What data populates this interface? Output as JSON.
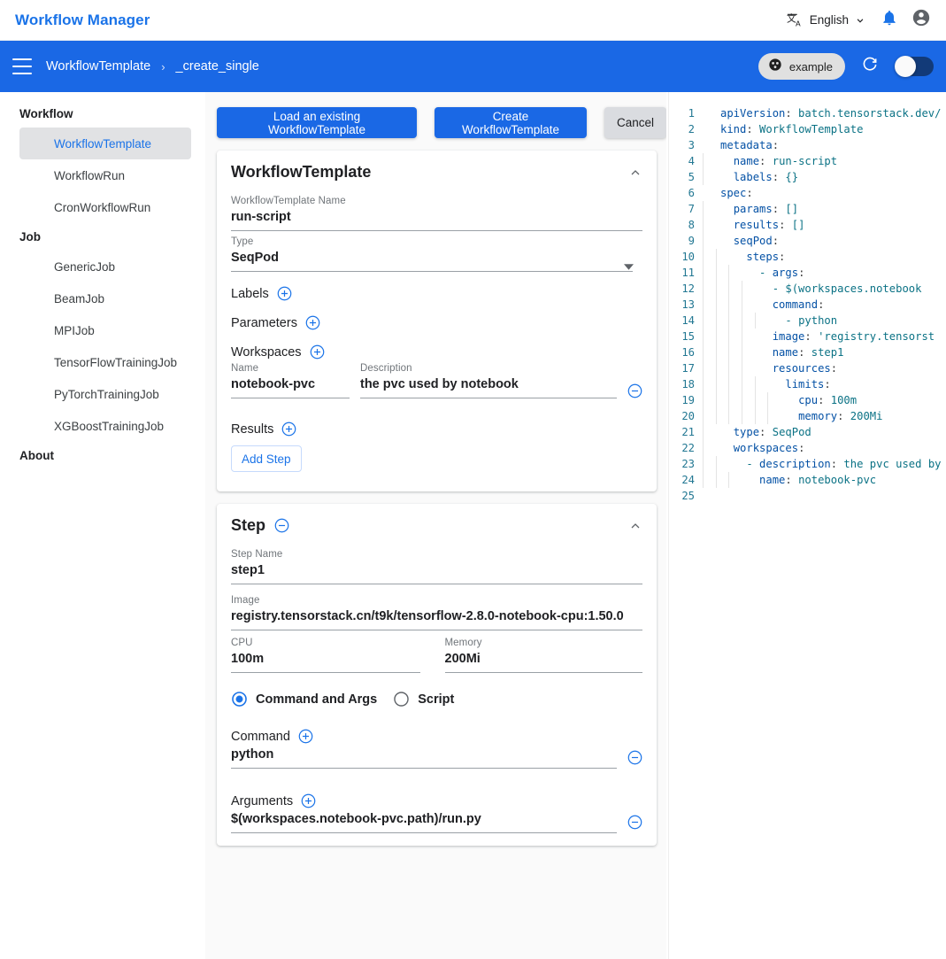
{
  "header": {
    "brand": "Workflow Manager",
    "translate_icon": "translate-icon",
    "language": "English",
    "chevron_icon": "chevron-down-icon",
    "bell_icon": "notifications-bell-icon",
    "account_icon": "account-circle-icon"
  },
  "breadcrumb": {
    "menu_icon": "hamburger-menu-icon",
    "parent": "WorkflowTemplate",
    "separator": "›",
    "current": "_create_single",
    "namespace_chip": {
      "icon": "namespace-icon",
      "label": "example"
    },
    "refresh_icon": "refresh-icon",
    "toggle_on": true
  },
  "sidebar": {
    "groups": [
      {
        "label": "Workflow",
        "items": [
          {
            "label": "WorkflowTemplate",
            "active": true
          },
          {
            "label": "WorkflowRun",
            "active": false
          },
          {
            "label": "CronWorkflowRun",
            "active": false
          }
        ]
      },
      {
        "label": "Job",
        "items": [
          {
            "label": "GenericJob",
            "active": false
          },
          {
            "label": "BeamJob",
            "active": false
          },
          {
            "label": "MPIJob",
            "active": false
          },
          {
            "label": "TensorFlowTrainingJob",
            "active": false
          },
          {
            "label": "PyTorchTrainingJob",
            "active": false
          },
          {
            "label": "XGBoostTrainingJob",
            "active": false
          }
        ]
      },
      {
        "label": "About",
        "items": []
      }
    ]
  },
  "toolbar": {
    "load_label": "Load an existing WorkflowTemplate",
    "create_label": "Create WorkflowTemplate",
    "cancel_label": "Cancel"
  },
  "template_card": {
    "title": "WorkflowTemplate",
    "collapse_icon": "chevron-up-icon",
    "name_label": "WorkflowTemplate Name",
    "name_value": "run-script",
    "type_label": "Type",
    "type_value": "SeqPod",
    "type_caret_icon": "dropdown-caret-icon",
    "labels_label": "Labels",
    "parameters_label": "Parameters",
    "workspaces_label": "Workspaces",
    "ws_name_label": "Name",
    "ws_name_value": "notebook-pvc",
    "ws_desc_label": "Description",
    "ws_desc_value": "the pvc used by notebook",
    "results_label": "Results",
    "add_step_label": "Add Step",
    "add_icon": "add-circle-icon",
    "remove_icon": "remove-circle-icon"
  },
  "step_card": {
    "title": "Step",
    "remove_icon": "remove-circle-icon",
    "collapse_icon": "chevron-up-icon",
    "step_name_label": "Step Name",
    "step_name_value": "step1",
    "image_label": "Image",
    "image_value": "registry.tensorstack.cn/t9k/tensorflow-2.8.0-notebook-cpu:1.50.0",
    "cpu_label": "CPU",
    "cpu_value": "100m",
    "memory_label": "Memory",
    "memory_value": "200Mi",
    "mode_command_label": "Command and Args",
    "mode_script_label": "Script",
    "mode_selected": "Command and Args",
    "radio_selected_icon": "radio-button-checked-icon",
    "radio_unselected_icon": "radio-button-unchecked-icon",
    "command_label": "Command",
    "command_value": "python",
    "arguments_label": "Arguments",
    "arguments_value": "$(workspaces.notebook-pvc.path)/run.py",
    "add_icon": "add-circle-icon",
    "minus_icon": "remove-circle-icon"
  },
  "editor": {
    "lines": [
      {
        "n": "1",
        "indent": 0,
        "text": "apiVersion: batch.tensorstack.dev/"
      },
      {
        "n": "2",
        "indent": 0,
        "text": "kind: WorkflowTemplate"
      },
      {
        "n": "3",
        "indent": 0,
        "text": "metadata:"
      },
      {
        "n": "4",
        "indent": 1,
        "text": "name: run-script"
      },
      {
        "n": "5",
        "indent": 1,
        "text": "labels: {}"
      },
      {
        "n": "6",
        "indent": 0,
        "text": "spec:"
      },
      {
        "n": "7",
        "indent": 1,
        "text": "params: []"
      },
      {
        "n": "8",
        "indent": 1,
        "text": "results: []"
      },
      {
        "n": "9",
        "indent": 1,
        "text": "seqPod:"
      },
      {
        "n": "10",
        "indent": 2,
        "text": "steps:"
      },
      {
        "n": "11",
        "indent": 3,
        "text": "- args:"
      },
      {
        "n": "12",
        "indent": 4,
        "text": "- $(workspaces.notebook"
      },
      {
        "n": "13",
        "indent": 4,
        "text": "command:"
      },
      {
        "n": "14",
        "indent": 5,
        "text": "- python"
      },
      {
        "n": "15",
        "indent": 4,
        "text": "image: 'registry.tensorst"
      },
      {
        "n": "16",
        "indent": 4,
        "text": "name: step1"
      },
      {
        "n": "17",
        "indent": 4,
        "text": "resources:"
      },
      {
        "n": "18",
        "indent": 5,
        "text": "limits:"
      },
      {
        "n": "19",
        "indent": 6,
        "text": "cpu: 100m"
      },
      {
        "n": "20",
        "indent": 6,
        "text": "memory: 200Mi"
      },
      {
        "n": "21",
        "indent": 1,
        "text": "type: SeqPod"
      },
      {
        "n": "22",
        "indent": 1,
        "text": "workspaces:"
      },
      {
        "n": "23",
        "indent": 2,
        "text": "- description: the pvc used by"
      },
      {
        "n": "24",
        "indent": 3,
        "text": "name: notebook-pvc"
      },
      {
        "n": "25",
        "indent": 0,
        "text": ""
      }
    ]
  },
  "colors": {
    "accent_blue": "#1a68e5",
    "link_blue": "#1a73e8",
    "bar_blue": "#1a68e5",
    "page_grey": "#fafafa",
    "toggle_track": "#123a78",
    "code_key": "#0451a5",
    "code_value": "#0b7285",
    "line_number": "#237893"
  }
}
